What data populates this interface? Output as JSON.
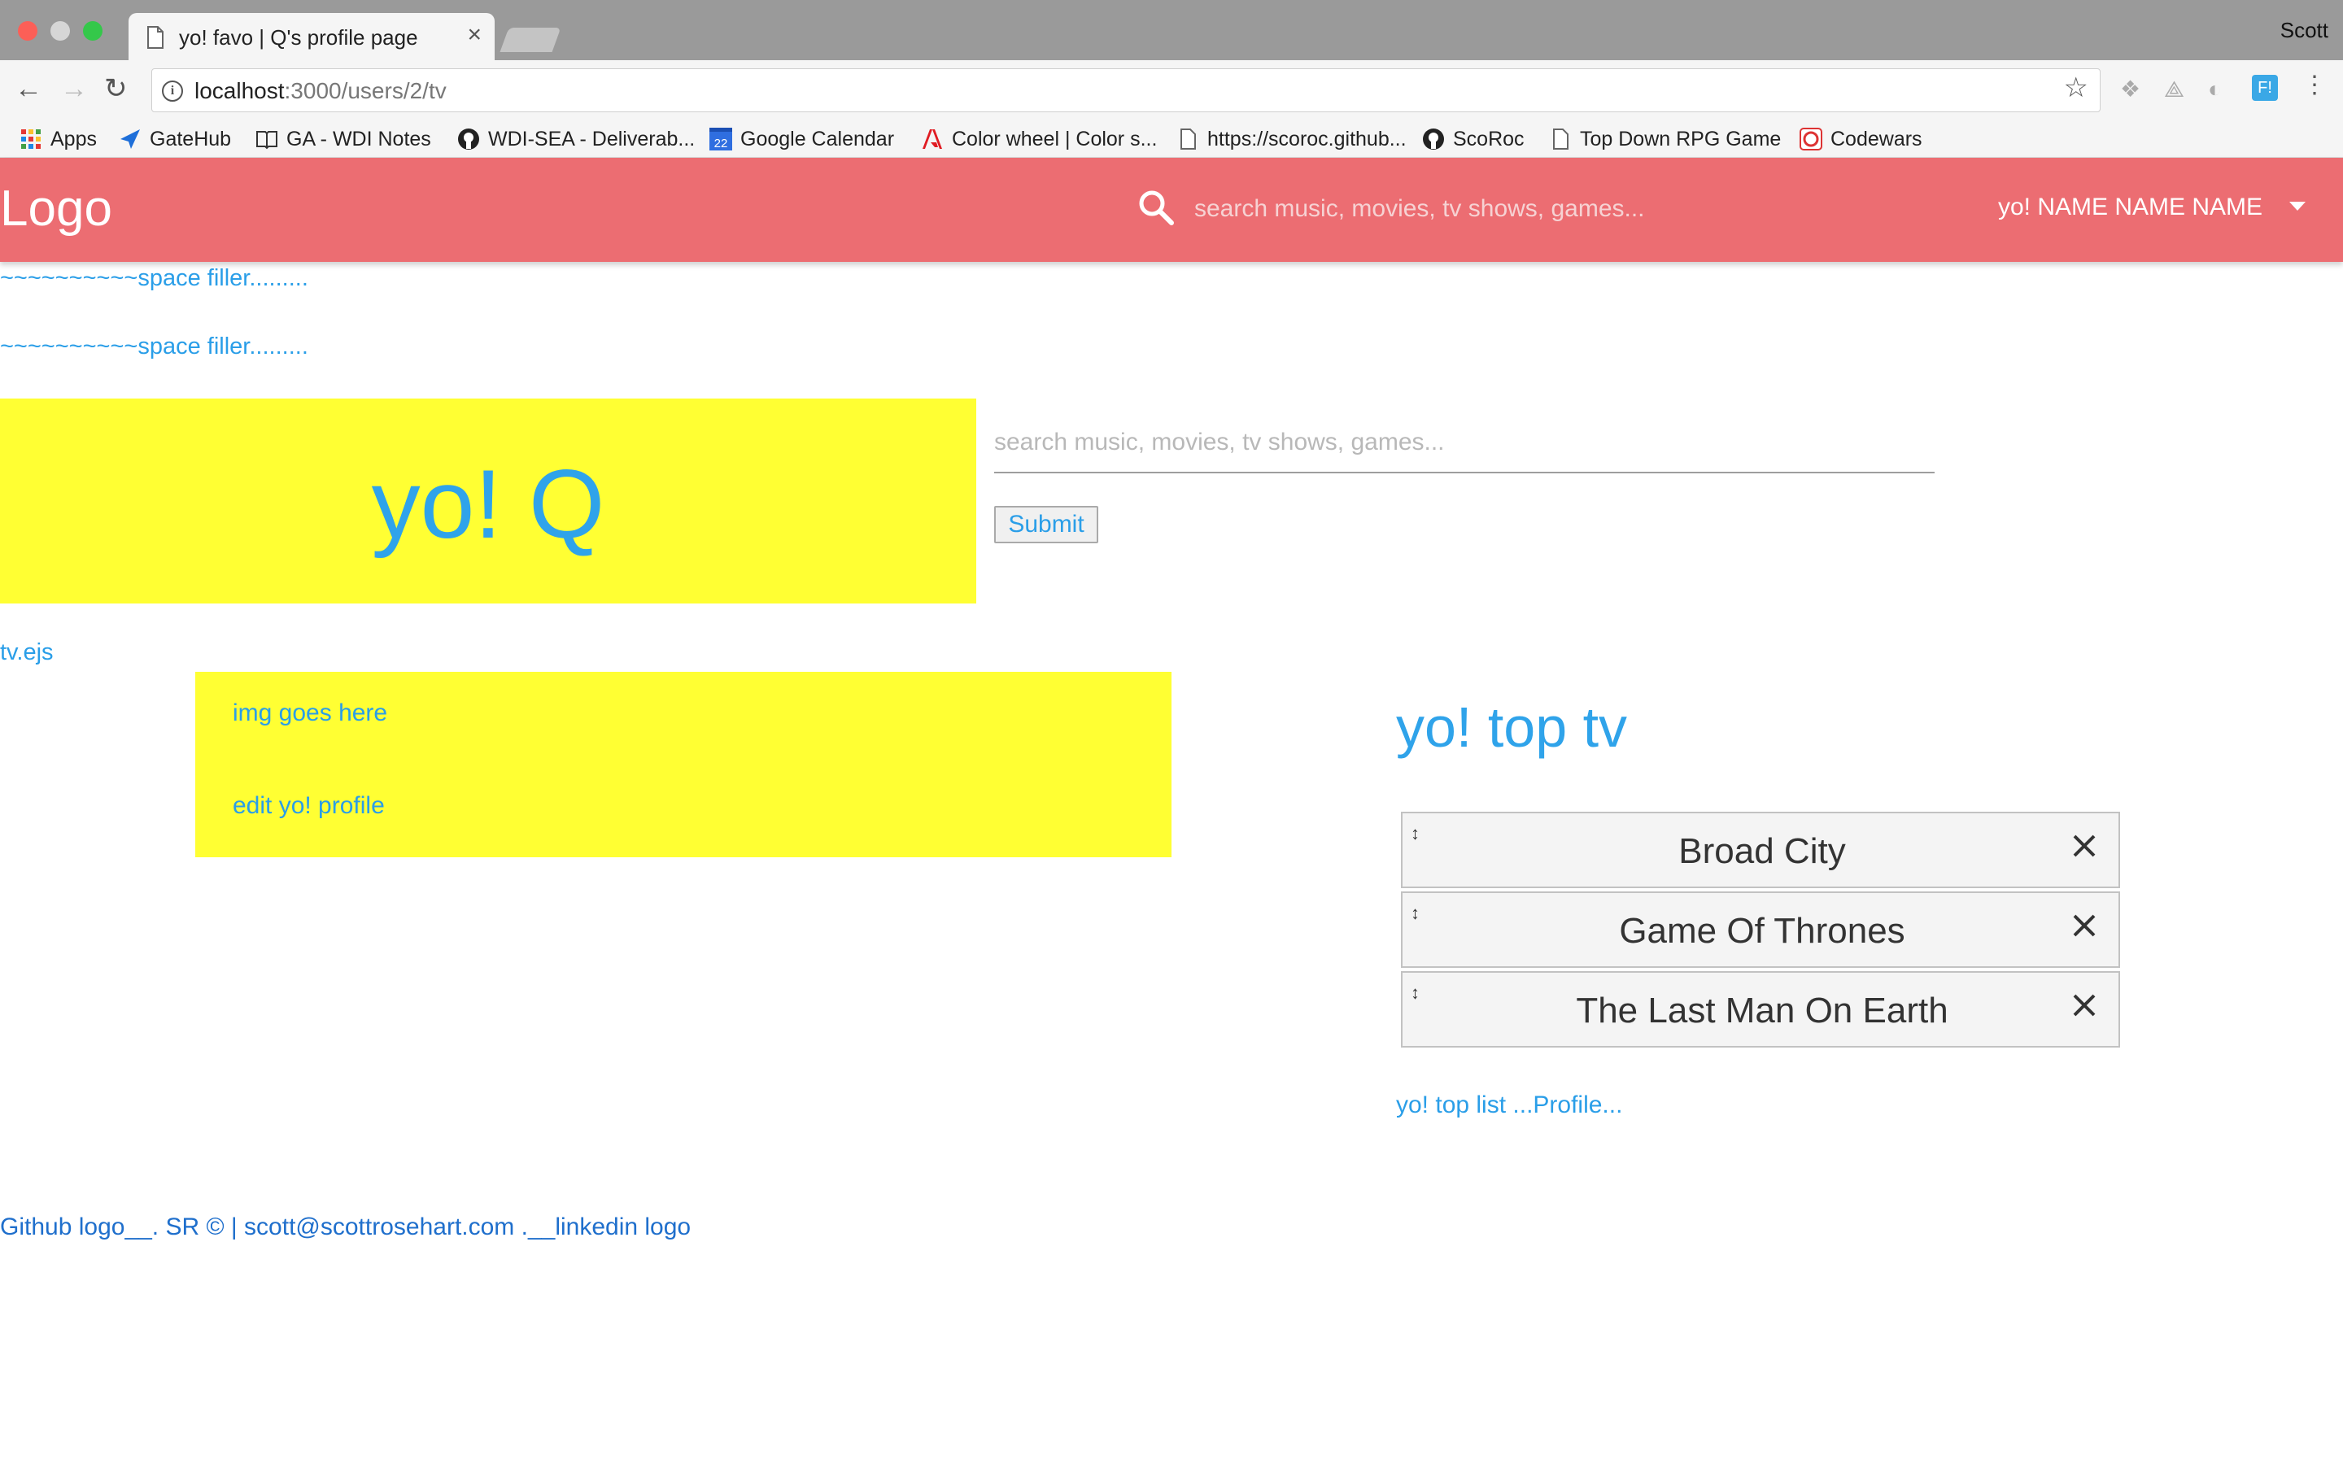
{
  "browser": {
    "tab_title": "yo! favo | Q's profile page",
    "profile_name": "Scott",
    "url_host": "localhost",
    "url_rest": ":3000/users/2/tv",
    "bookmarks": [
      {
        "label": "Apps",
        "icon": "apps-grid-icon"
      },
      {
        "label": "GateHub",
        "icon": "gatehub-icon"
      },
      {
        "label": "GA - WDI Notes",
        "icon": "book-icon"
      },
      {
        "label": "WDI-SEA - Deliverab...",
        "icon": "github-icon"
      },
      {
        "label": "Google Calendar",
        "icon": "calendar-icon"
      },
      {
        "label": "Color wheel | Color s...",
        "icon": "adobe-icon"
      },
      {
        "label": "https://scoroc.github...",
        "icon": "page-icon"
      },
      {
        "label": "ScoRoc",
        "icon": "github-icon"
      },
      {
        "label": "Top Down RPG Game",
        "icon": "page-icon"
      },
      {
        "label": "Codewars",
        "icon": "codewars-icon"
      }
    ],
    "calendar_day": "22",
    "extension_badge": "F!"
  },
  "header": {
    "logo": "Logo",
    "search_placeholder": "search music, movies, tv shows, games...",
    "user_label": "yo! NAME NAME NAME"
  },
  "fillers": [
    "~~~~~~~~~~space filler.........",
    "~~~~~~~~~~space filler........."
  ],
  "hero": {
    "title": "yo! Q"
  },
  "search": {
    "placeholder": "search music, movies, tv shows, games...",
    "submit_label": "Submit"
  },
  "template_label": "tv.ejs",
  "profile_box": {
    "img_label": "img goes here",
    "edit_label": "edit yo! profile"
  },
  "top_list": {
    "title": "yo! top tv",
    "items": [
      "Broad City",
      "Game Of Thrones",
      "The Last Man On Earth"
    ],
    "footer_link": "yo! top list ...Profile..."
  },
  "footer": {
    "text": "Github logo__. SR © | scott@scottrosehart.com .__linkedin logo"
  },
  "colors": {
    "header_bg": "#ec6d72",
    "highlight_bg": "#ffff33",
    "link": "#2a9ee8"
  }
}
